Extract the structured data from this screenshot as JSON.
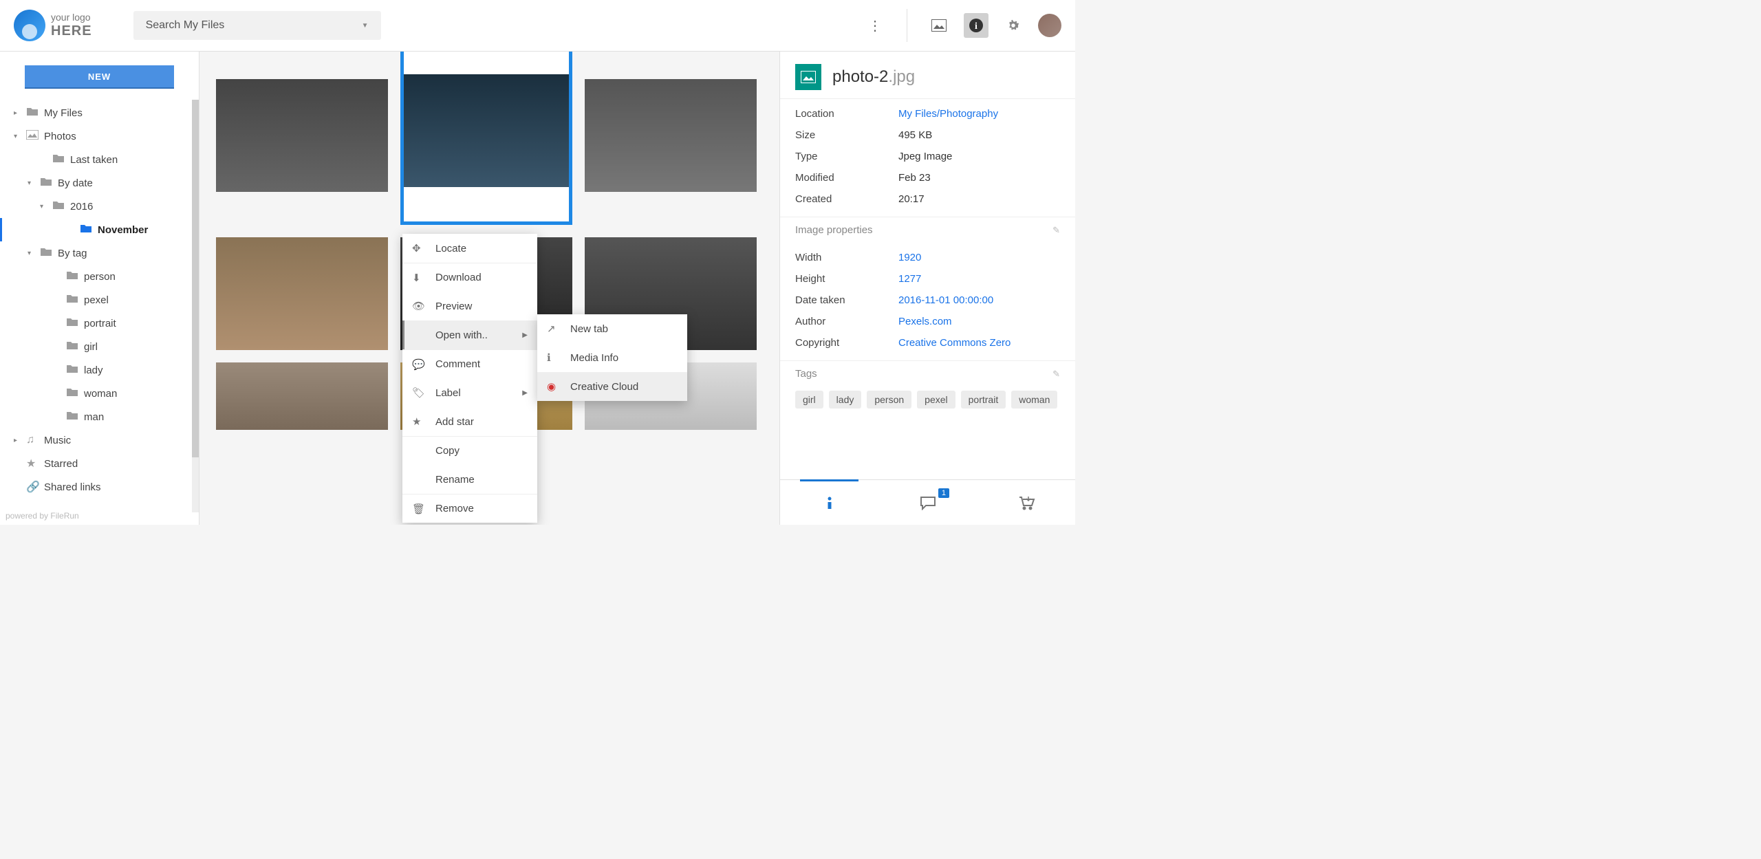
{
  "header": {
    "logo_line1": "your logo",
    "logo_line2": "HERE",
    "search_placeholder": "Search My Files"
  },
  "sidebar": {
    "new_button": "NEW",
    "items": [
      {
        "label": "My Files",
        "expand": "▸",
        "level": 1,
        "icon": "folder"
      },
      {
        "label": "Photos",
        "expand": "▾",
        "level": 1,
        "icon": "image"
      },
      {
        "label": "Last taken",
        "expand": "",
        "level": 3,
        "icon": "folder"
      },
      {
        "label": "By date",
        "expand": "▾",
        "level": 2,
        "icon": "folder"
      },
      {
        "label": "2016",
        "expand": "▾",
        "level": 3,
        "icon": "folder"
      },
      {
        "label": "November",
        "expand": "",
        "level": 5,
        "icon": "folder",
        "selected": true
      },
      {
        "label": "By tag",
        "expand": "▾",
        "level": 2,
        "icon": "folder"
      },
      {
        "label": "person",
        "expand": "",
        "level": 4,
        "icon": "folder"
      },
      {
        "label": "pexel",
        "expand": "",
        "level": 4,
        "icon": "folder"
      },
      {
        "label": "portrait",
        "expand": "",
        "level": 4,
        "icon": "folder"
      },
      {
        "label": "girl",
        "expand": "",
        "level": 4,
        "icon": "folder"
      },
      {
        "label": "lady",
        "expand": "",
        "level": 4,
        "icon": "folder"
      },
      {
        "label": "woman",
        "expand": "",
        "level": 4,
        "icon": "folder"
      },
      {
        "label": "man",
        "expand": "",
        "level": 4,
        "icon": "folder"
      },
      {
        "label": "Music",
        "expand": "▸",
        "level": 1,
        "icon": "music"
      },
      {
        "label": "Starred",
        "expand": "",
        "level": 1,
        "icon": "star"
      },
      {
        "label": "Shared links",
        "expand": "",
        "level": 1,
        "icon": "link"
      }
    ],
    "footer": "powered by FileRun"
  },
  "context_menu": {
    "items": [
      {
        "label": "Locate",
        "icon": "✥"
      },
      {
        "label": "Download",
        "icon": "⬇",
        "sep": true
      },
      {
        "label": "Preview",
        "icon": "👁"
      },
      {
        "label": "Open with..",
        "icon": "",
        "arrow": true,
        "hover": true
      },
      {
        "label": "Comment",
        "icon": "💬",
        "sep": true
      },
      {
        "label": "Label",
        "icon": "🏷",
        "arrow": true
      },
      {
        "label": "Add star",
        "icon": "★"
      },
      {
        "label": "Copy",
        "icon": "",
        "sep": true
      },
      {
        "label": "Rename",
        "icon": ""
      },
      {
        "label": "Remove",
        "icon": "🗑",
        "sep": true
      }
    ],
    "submenu": [
      {
        "label": "New tab",
        "icon": "↗"
      },
      {
        "label": "Media Info",
        "icon": "ℹ"
      },
      {
        "label": "Creative Cloud",
        "icon": "cc",
        "hover": true
      }
    ]
  },
  "details": {
    "filename": "photo-2",
    "ext": ".jpg",
    "rows": [
      {
        "k": "Location",
        "v": "My Files/Photography",
        "link": true
      },
      {
        "k": "Size",
        "v": "495 KB"
      },
      {
        "k": "Type",
        "v": "Jpeg Image"
      },
      {
        "k": "Modified",
        "v": "Feb 23"
      },
      {
        "k": "Created",
        "v": "20:17"
      }
    ],
    "image_props_title": "Image properties",
    "image_props": [
      {
        "k": "Width",
        "v": "1920",
        "link": true
      },
      {
        "k": "Height",
        "v": "1277",
        "link": true
      },
      {
        "k": "Date taken",
        "v": "2016-11-01 00:00:00",
        "link": true
      },
      {
        "k": "Author",
        "v": "Pexels.com",
        "link": true
      },
      {
        "k": "Copyright",
        "v": "Creative Commons Zero",
        "link": true
      }
    ],
    "tags_title": "Tags",
    "tags": [
      "girl",
      "lady",
      "person",
      "pexel",
      "portrait",
      "woman"
    ],
    "comments_badge": "1"
  }
}
